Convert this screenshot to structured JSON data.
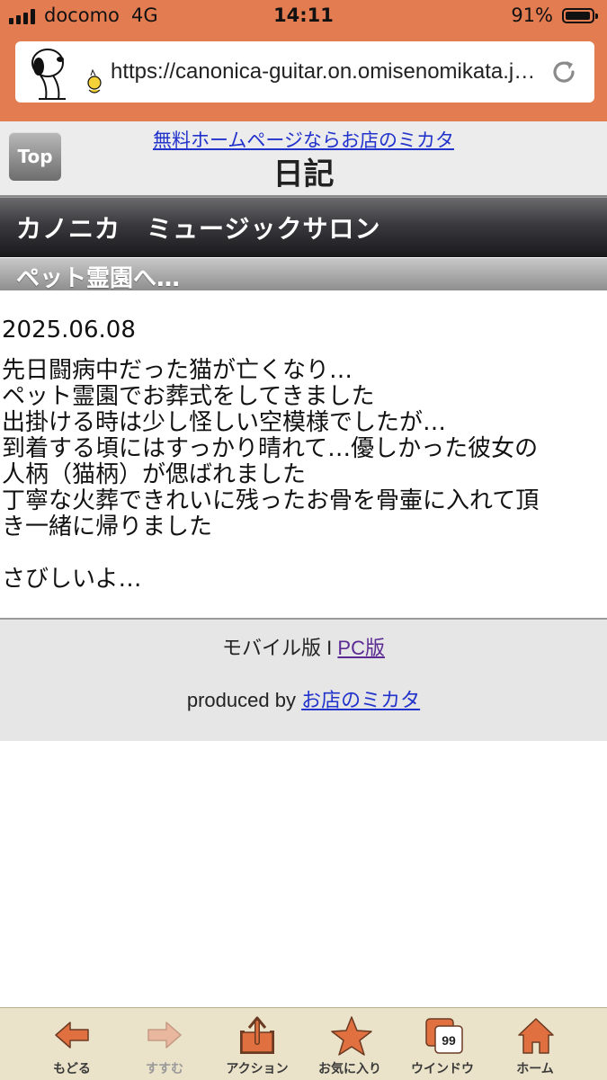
{
  "status": {
    "carrier": "docomo",
    "network": "4G",
    "time": "14:11",
    "battery": "91%",
    "battery_level": 0.91
  },
  "browser": {
    "url": "https://canonica-guitar.on.omisenomikata.jp/..."
  },
  "header": {
    "top_button": "Top",
    "ad_link": "無料ホームページならお店のミカタ",
    "title": "日記"
  },
  "site": {
    "name": "カノニカ　ミュージックサロン"
  },
  "entry": {
    "title": "ペット霊園へ…",
    "date": "2025.06.08",
    "lines": [
      "先日闘病中だった猫が亡くなり…",
      "ペット霊園でお葬式をしてきました",
      "出掛ける時は少し怪しい空模様でしたが…",
      "到着する頃にはすっかり晴れて…優しかった彼女の",
      "人柄（猫柄）が偲ばれました",
      "丁寧な火葬できれいに残ったお骨を骨壷に入れて頂",
      "き一緒に帰りました",
      "",
      "さびしいよ…"
    ]
  },
  "footer": {
    "mobile_label": "モバイル版",
    "separator": "I",
    "pc_link": "PC版",
    "produced_by": "produced by",
    "produced_link": "お店のミカタ"
  },
  "toolbar": {
    "items": [
      {
        "label": "もどる",
        "icon": "back-arrow-icon"
      },
      {
        "label": "すすむ",
        "icon": "forward-arrow-icon"
      },
      {
        "label": "アクション",
        "icon": "share-icon"
      },
      {
        "label": "お気に入り",
        "icon": "star-icon"
      },
      {
        "label": "ウインドウ",
        "icon": "windows-icon",
        "badge": "99"
      },
      {
        "label": "ホーム",
        "icon": "home-icon"
      }
    ]
  },
  "colors": {
    "chrome": "#e47c52",
    "toolbar_bg": "#ebe3c9",
    "icon_orange": "#e0703f",
    "link": "#2233cc"
  }
}
